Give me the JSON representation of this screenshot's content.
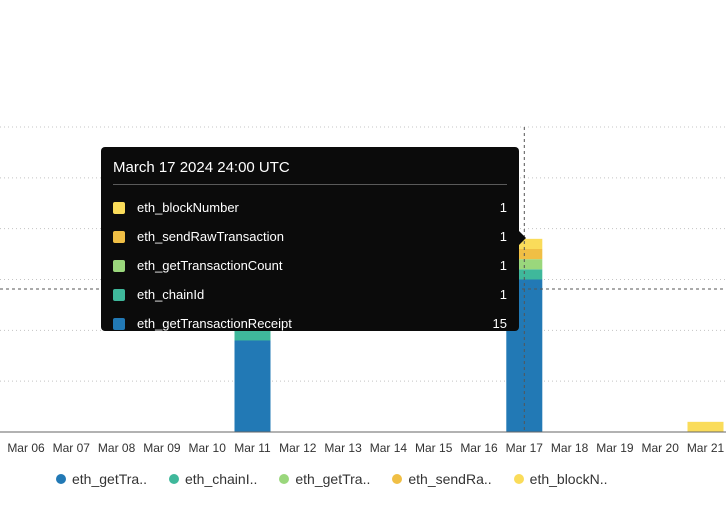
{
  "chart_data": {
    "type": "bar",
    "stacked": true,
    "categories": [
      "Mar 06",
      "Mar 07",
      "Mar 08",
      "Mar 09",
      "Mar 10",
      "Mar 11",
      "Mar 12",
      "Mar 13",
      "Mar 14",
      "Mar 15",
      "Mar 16",
      "Mar 17",
      "Mar 18",
      "Mar 19",
      "Mar 20",
      "Mar 21"
    ],
    "series": [
      {
        "name": "eth_getTransactionReceipt",
        "legend": "eth_getTra..",
        "color": "#2279b5",
        "values": [
          0,
          0,
          0,
          0,
          0,
          9,
          0,
          0,
          0,
          0,
          0,
          15,
          0,
          0,
          0,
          0
        ]
      },
      {
        "name": "eth_chainId",
        "legend": "eth_chainI..",
        "color": "#3fb89b",
        "values": [
          0,
          0,
          0,
          0,
          0,
          1,
          0,
          0,
          0,
          0,
          0,
          1,
          0,
          0,
          0,
          0
        ]
      },
      {
        "name": "eth_getTransactionCount",
        "legend": "eth_getTra..",
        "color": "#9ad77c",
        "values": [
          0,
          0,
          0,
          0,
          0,
          1,
          0,
          0,
          0,
          0,
          0,
          1,
          0,
          0,
          0,
          0
        ]
      },
      {
        "name": "eth_sendRawTransaction",
        "legend": "eth_sendRa..",
        "color": "#f0bf45",
        "values": [
          0,
          0,
          0,
          0,
          0,
          1,
          0,
          0,
          0,
          0,
          0,
          1,
          0,
          0,
          0,
          0
        ]
      },
      {
        "name": "eth_blockNumber",
        "legend": "eth_blockN..",
        "color": "#fadc5a",
        "values": [
          0,
          0,
          0,
          0,
          0,
          1,
          0,
          0,
          0,
          0,
          0,
          1,
          0,
          0,
          0,
          1
        ]
      }
    ],
    "ylim": [
      0,
      30
    ],
    "grid": true,
    "legend_position": "bottom",
    "hover_category": "Mar 17"
  },
  "tooltip": {
    "title": "March 17 2024 24:00 UTC",
    "rows": [
      {
        "name": "eth_blockNumber",
        "value": "1",
        "color": "#fadc5a"
      },
      {
        "name": "eth_sendRawTransaction",
        "value": "1",
        "color": "#f0bf45"
      },
      {
        "name": "eth_getTransactionCount",
        "value": "1",
        "color": "#9ad77c"
      },
      {
        "name": "eth_chainId",
        "value": "1",
        "color": "#3fb89b"
      },
      {
        "name": "eth_getTransactionReceipt",
        "value": "15",
        "color": "#2279b5"
      }
    ]
  }
}
